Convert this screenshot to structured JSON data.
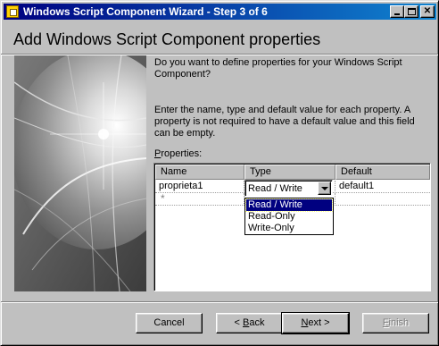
{
  "window": {
    "title": "Windows Script Component Wizard - Step 3 of 6",
    "controls": {
      "minimize": "",
      "maximize": "",
      "close": "✕"
    }
  },
  "page": {
    "heading": "Add Windows Script Component properties",
    "intro": "Do you want to define properties for your Windows Script Component?",
    "instructions": "Enter the name, type and default value for each property. A property is not required to have a default value and this field can be empty."
  },
  "properties_label": {
    "accel": "P",
    "rest": "roperties:"
  },
  "grid": {
    "columns": [
      "Name",
      "Type",
      "Default"
    ],
    "rows": [
      {
        "name": "proprieta1",
        "type": "Read / Write",
        "default": "default1"
      }
    ],
    "new_row_marker": "*"
  },
  "type_dropdown": {
    "selected": "Read / Write",
    "options": [
      "Read / Write",
      "Read-Only",
      "Write-Only"
    ]
  },
  "buttons": {
    "cancel": "Cancel",
    "back": {
      "symbol": "< ",
      "accel": "B",
      "rest": "ack"
    },
    "next": {
      "accel": "N",
      "rest": "ext",
      "symbol": " >"
    },
    "finish": {
      "accel": "F",
      "rest": "inish"
    }
  },
  "colors": {
    "face": "#c0c0c0",
    "title_start": "#000080",
    "title_end": "#1084d0",
    "highlight": "#000080"
  },
  "icons": {
    "app": "wizard-app-icon",
    "dropdown": "chevron-down-icon",
    "new_row": "asterisk-icon"
  }
}
